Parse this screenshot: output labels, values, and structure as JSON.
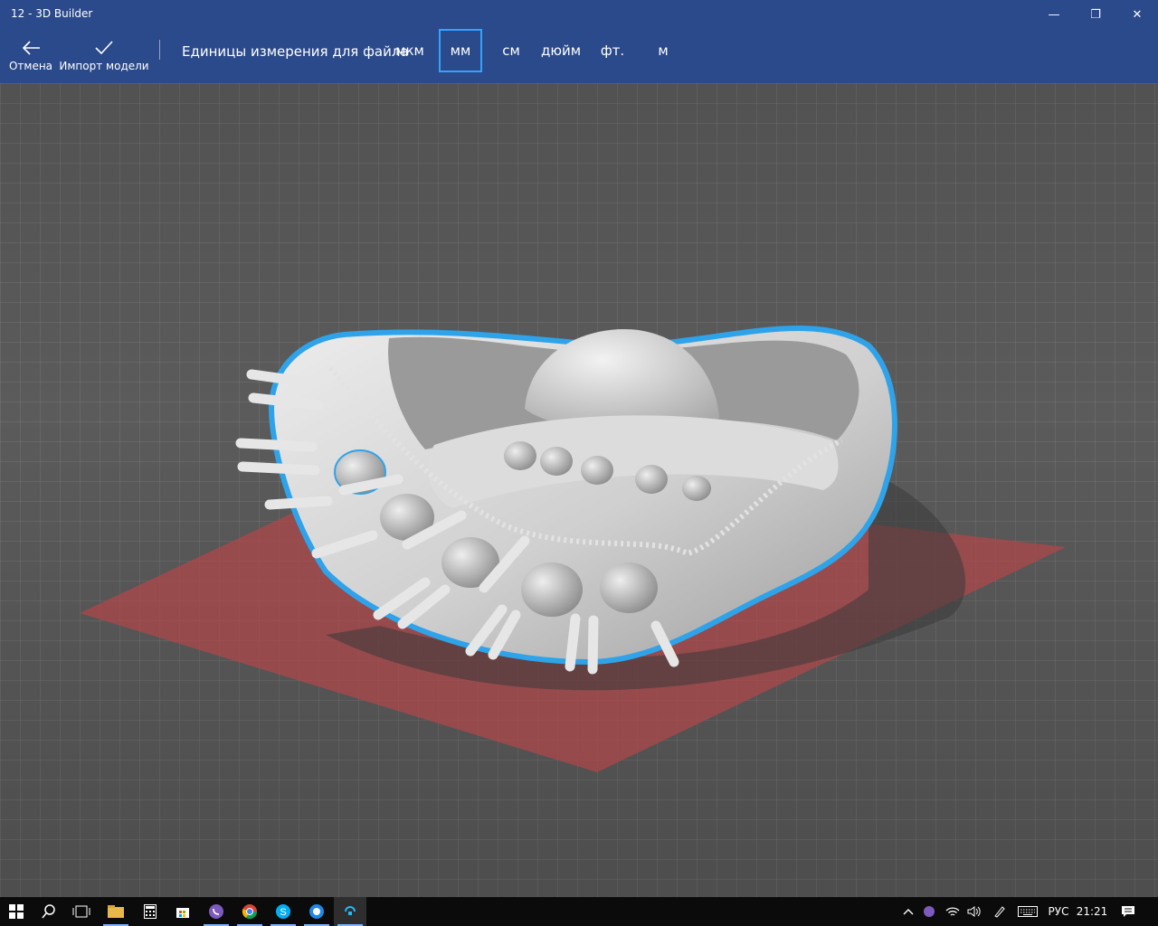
{
  "window": {
    "title": "12 - 3D Builder",
    "minimize_glyph": "—",
    "maximize_glyph": "❐",
    "close_glyph": "✕"
  },
  "toolbar": {
    "cancel_label": "Отмена",
    "import_label": "Импорт модели",
    "units_label": "Единицы измерения для файла",
    "units": [
      "мкм",
      "мм",
      "см",
      "дюйм",
      "фт.",
      "м"
    ],
    "selected_unit": "мм"
  },
  "taskbar": {
    "apps": [
      "start-icon",
      "search-icon",
      "task-view-icon",
      "file-explorer-icon",
      "calculator-icon",
      "store-icon",
      "viber-icon",
      "chrome-icon",
      "skype-icon",
      "browser-icon",
      "3d-builder-icon"
    ],
    "language": "РУС",
    "time": "21:21"
  },
  "colors": {
    "titlebar": "#2b4a8b",
    "accent": "#33a3ff",
    "build_plate": "#b0474a",
    "model": "#d6d6d6",
    "outline": "#2ea3ea"
  }
}
